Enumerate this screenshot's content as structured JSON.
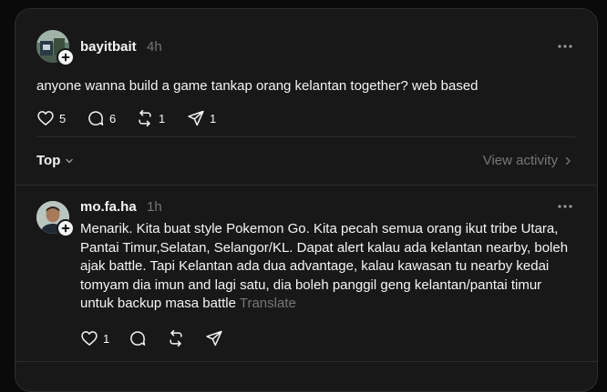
{
  "post": {
    "username": "bayitbait",
    "time": "4h",
    "text": "anyone wanna build a game tankap orang kelantan together? web based",
    "likes": "5",
    "replies": "6",
    "reposts": "1",
    "shares": "1"
  },
  "sort": {
    "label": "Top",
    "view_activity": "View activity"
  },
  "reply": {
    "username": "mo.fa.ha",
    "time": "1h",
    "lines": [
      "Menarik. Kita buat style Pokemon Go. Kita pecah semua orang ikut tribe Utara,",
      "Pantai Timur,Selatan, Selangor/KL. Dapat alert kalau ada kelantan nearby, boleh",
      "ajak battle. Tapi Kelantan ada dua advantage, kalau kawasan tu nearby kedai",
      "tomyam dia imun and lagi satu, dia boleh panggil geng kelantan/pantai timur",
      "untuk backup masa battle"
    ],
    "translate": "Translate",
    "likes": "1"
  },
  "icons": [
    "heart-icon",
    "comment-icon",
    "repost-icon",
    "share-icon",
    "more-icon",
    "plus-icon",
    "chevron-down-icon",
    "chevron-right-icon"
  ],
  "colors": {
    "background": "#0a0a0a",
    "card": "#181818",
    "text": "#f3f5f7",
    "muted": "#777777",
    "border": "#2d2d2d"
  }
}
